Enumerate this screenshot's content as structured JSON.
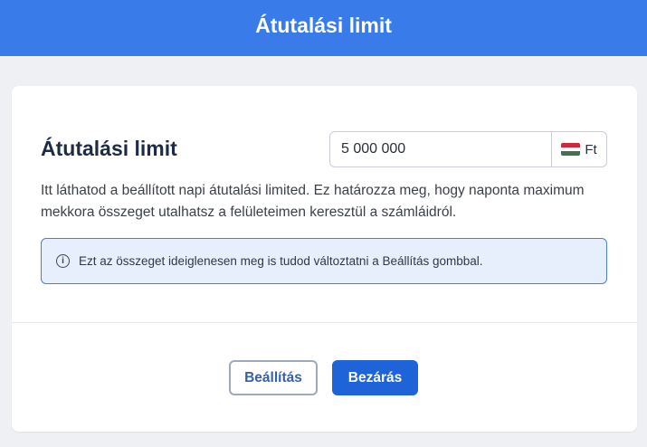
{
  "header": {
    "title": "Átutalási limit"
  },
  "limit": {
    "title": "Átutalási limit",
    "amount_value": "5 000 000",
    "currency": "Ft",
    "flag_colors": [
      "#ce2939",
      "#ffffff",
      "#477050"
    ],
    "description": "Itt láthatod a beállított napi átutalási limited. Ez határozza meg, hogy naponta maximum mekkora összeget utalhatsz a felületeimen keresztül a számláidról.",
    "info_icon": "info-icon",
    "info_text": "Ezt az összeget ideiglenesen meg is tudod változtatni a Beállítás gombbal."
  },
  "actions": {
    "settings_label": "Beállítás",
    "close_label": "Bezárás"
  },
  "colors": {
    "header_bg": "#3a7bea",
    "primary": "#1e63d8",
    "info_bg": "#e6effb",
    "info_border": "#4d7fcf"
  }
}
